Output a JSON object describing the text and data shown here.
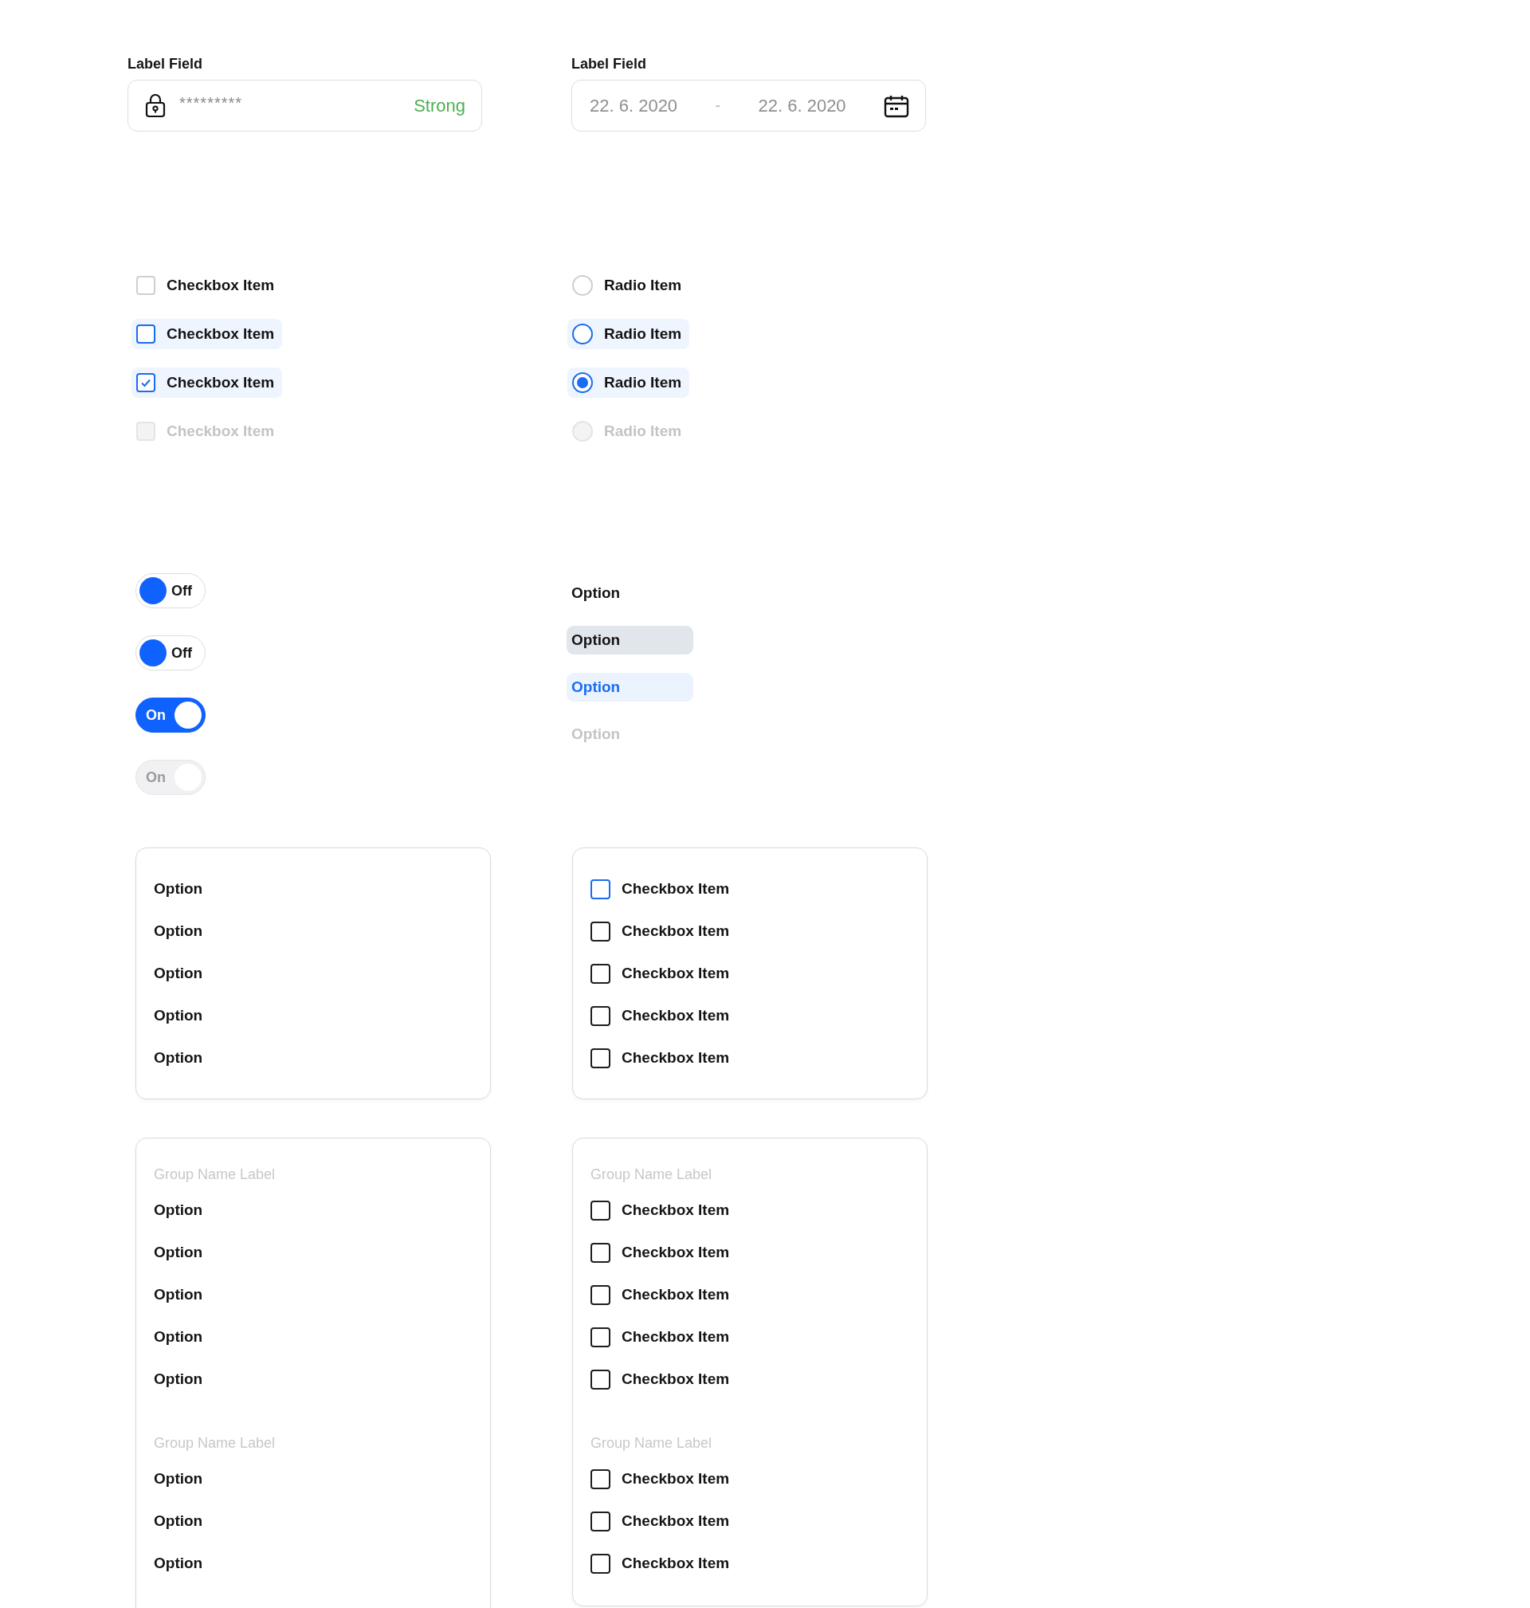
{
  "password_field": {
    "label": "Label Field",
    "value": "*********",
    "strength": "Strong"
  },
  "date_range_field": {
    "label": "Label Field",
    "start": "22. 6. 2020",
    "separator": "-",
    "end": "22. 6. 2020"
  },
  "checkboxes": [
    {
      "label": "Checkbox Item",
      "hovered": false,
      "checked": false,
      "disabled": false
    },
    {
      "label": "Checkbox Item",
      "hovered": true,
      "checked": false,
      "disabled": false
    },
    {
      "label": "Checkbox Item",
      "hovered": true,
      "checked": true,
      "disabled": false
    },
    {
      "label": "Checkbox Item",
      "hovered": false,
      "checked": false,
      "disabled": true
    }
  ],
  "radios": [
    {
      "label": "Radio Item",
      "hovered": false,
      "selected": false,
      "disabled": false
    },
    {
      "label": "Radio Item",
      "hovered": true,
      "selected": false,
      "disabled": false
    },
    {
      "label": "Radio Item",
      "hovered": true,
      "selected": true,
      "disabled": false
    },
    {
      "label": "Radio Item",
      "hovered": false,
      "selected": false,
      "disabled": true
    }
  ],
  "toggles": [
    {
      "label": "Off",
      "on": false,
      "disabled": false
    },
    {
      "label": "Off",
      "on": false,
      "disabled": false
    },
    {
      "label": "On",
      "on": true,
      "disabled": false
    },
    {
      "label": "On",
      "on": true,
      "disabled": true
    }
  ],
  "options": [
    {
      "label": "Option",
      "hovered": false,
      "selected": false,
      "disabled": false
    },
    {
      "label": "Option",
      "hovered": true,
      "selected": false,
      "disabled": false
    },
    {
      "label": "Option",
      "hovered": false,
      "selected": true,
      "disabled": false
    },
    {
      "label": "Option",
      "hovered": false,
      "selected": false,
      "disabled": true
    }
  ],
  "option_list": {
    "items": [
      "Option",
      "Option",
      "Option",
      "Option",
      "Option"
    ]
  },
  "checkbox_list": {
    "items": [
      {
        "label": "Checkbox Item",
        "checked": false,
        "focused": true
      },
      {
        "label": "Checkbox Item",
        "checked": false,
        "focused": false
      },
      {
        "label": "Checkbox Item",
        "checked": false,
        "focused": false
      },
      {
        "label": "Checkbox Item",
        "checked": false,
        "focused": false
      },
      {
        "label": "Checkbox Item",
        "checked": false,
        "focused": false
      }
    ]
  },
  "grouped_option_list": {
    "groups": [
      {
        "label": "Group Name Label",
        "items": [
          "Option",
          "Option",
          "Option",
          "Option",
          "Option"
        ]
      },
      {
        "label": "Group Name Label",
        "items": [
          "Option",
          "Option",
          "Option"
        ]
      }
    ]
  },
  "grouped_checkbox_list": {
    "groups": [
      {
        "label": "Group Name Label",
        "items": [
          {
            "label": "Checkbox Item",
            "checked": false,
            "focused": false
          },
          {
            "label": "Checkbox Item",
            "checked": false,
            "focused": false
          },
          {
            "label": "Checkbox Item",
            "checked": false,
            "focused": false
          },
          {
            "label": "Checkbox Item",
            "checked": false,
            "focused": false
          },
          {
            "label": "Checkbox Item",
            "checked": false,
            "focused": false
          }
        ]
      },
      {
        "label": "Group Name Label",
        "items": [
          {
            "label": "Checkbox Item",
            "checked": false,
            "focused": false
          },
          {
            "label": "Checkbox Item",
            "checked": false,
            "focused": false
          },
          {
            "label": "Checkbox Item",
            "checked": false,
            "focused": false
          }
        ]
      }
    ]
  }
}
